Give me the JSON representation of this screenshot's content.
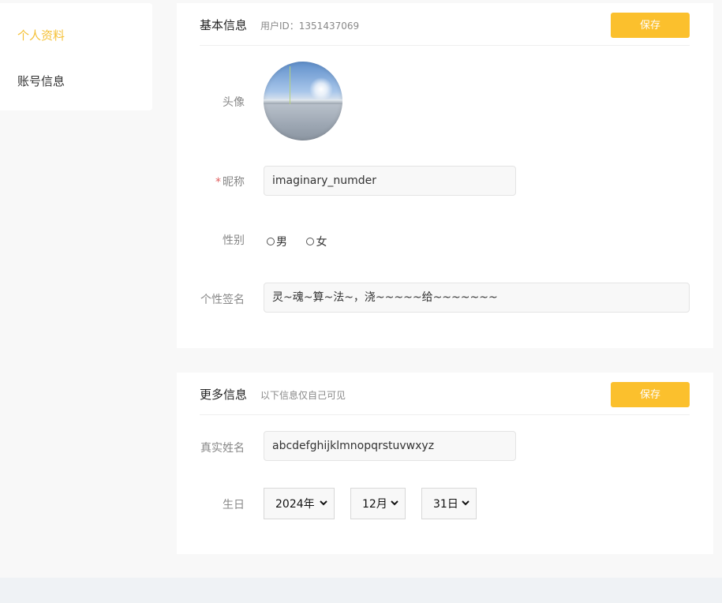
{
  "sidebar": {
    "items": [
      {
        "label": "个人资料",
        "active": true
      },
      {
        "label": "账号信息",
        "active": false
      }
    ]
  },
  "basic": {
    "title": "基本信息",
    "user_id": "用户ID：1351437069",
    "save_label": "保存",
    "avatar_label": "头像",
    "nickname_label": "昵称",
    "nickname_required": "*",
    "nickname_value": "imaginary_numder",
    "gender_label": "性别",
    "gender_options": [
      "男",
      "女"
    ],
    "signature_label": "个性签名",
    "signature_value": "灵~魂~算~法~，浇~~~~~给~~~~~~~"
  },
  "more": {
    "title": "更多信息",
    "subtitle": "以下信息仅自己可见",
    "save_label": "保存",
    "realname_label": "真实姓名",
    "realname_value": "abcdefghijklmnopqrstuvwxyz",
    "birthday_label": "生日",
    "year": "2024年",
    "month": "12月",
    "day": "31日"
  },
  "colors": {
    "accent": "#fbc02d",
    "active_nav": "#f5c138",
    "required": "#e05d5d"
  }
}
